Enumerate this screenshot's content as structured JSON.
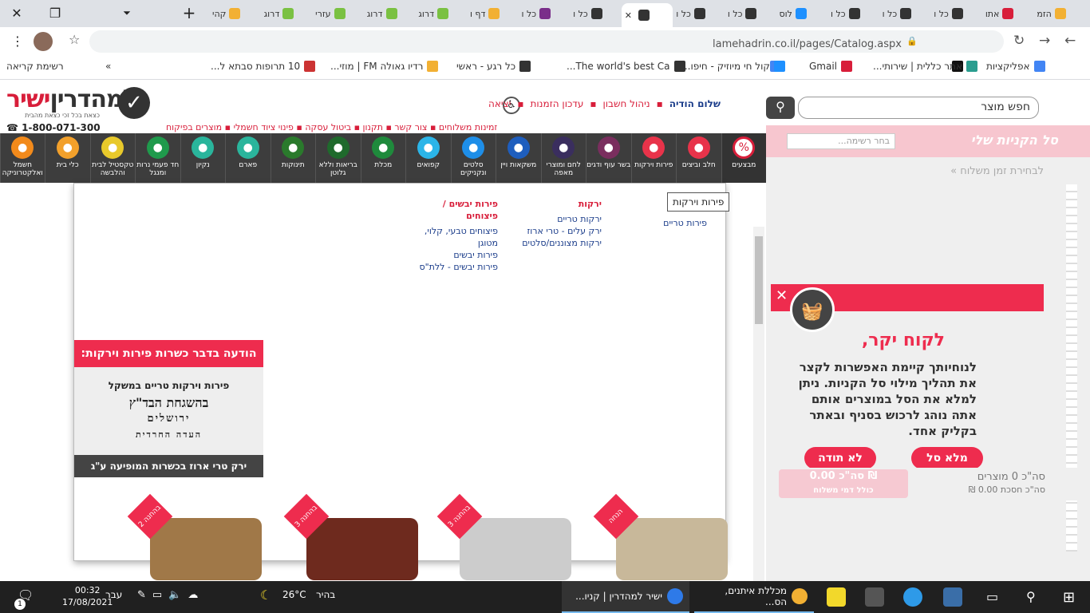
{
  "browser": {
    "tabs": [
      {
        "label": "הזמ",
        "color": "#f2b033"
      },
      {
        "label": "אתו",
        "color": "#d81e3a"
      },
      {
        "label": "כל ו",
        "color": "#333333"
      },
      {
        "label": "כל ו",
        "color": "#333333"
      },
      {
        "label": "כל ו",
        "color": "#333333"
      },
      {
        "label": "לוס",
        "color": "#1e90ff"
      },
      {
        "label": "כל ו",
        "color": "#333333"
      },
      {
        "label": "כל ו",
        "color": "#333333"
      },
      {
        "label": "",
        "color": "#333333",
        "active": true
      },
      {
        "label": "כל ו",
        "color": "#333333"
      },
      {
        "label": "כל ו",
        "color": "#7a2e8a"
      },
      {
        "label": "דף ו",
        "color": "#f2b033"
      },
      {
        "label": "דרוג",
        "color": "#7ac142"
      },
      {
        "label": "דרוג",
        "color": "#7ac142"
      },
      {
        "label": "עזרי",
        "color": "#7ac142"
      },
      {
        "label": "דרוג",
        "color": "#7ac142"
      },
      {
        "label": "קהי",
        "color": "#f2b033"
      }
    ],
    "url": "lamehadrin.co.il/pages/Catalog.aspx",
    "bookmarks": [
      {
        "label": "אפליקציות",
        "color": "#4285f4"
      },
      {
        "label": "",
        "color": "#111111"
      },
      {
        "label": "אתר כללית | שירותי...",
        "color": "#2a9d8f"
      },
      {
        "label": "Gmail",
        "color": "#d81e3a"
      },
      {
        "label": "",
        "color": "#4285f4"
      },
      {
        "label": "קול חי מיוזיק - חיפו...",
        "color": "#1e90ff"
      },
      {
        "label": "The world's best Ca...",
        "color": "#333333"
      },
      {
        "label": "כל רגע - ראשי",
        "color": "#333333"
      },
      {
        "label": "רדיו גאולה FM | מוזי...",
        "color": "#f2b033"
      },
      {
        "label": "10 תרופות סבתא ל...",
        "color": "#cc3333"
      },
      {
        "label": "»",
        "color": ""
      },
      {
        "label": "רשימת קריאה",
        "color": ""
      }
    ]
  },
  "site": {
    "logo_word_red": "ישיר",
    "logo_word_dark": "למהדרין",
    "logo_sub": "כצאת בכל זכי כצאת מהבית",
    "phone": "1-800-071-300",
    "greeting": "שלום הודיה",
    "topnav": [
      "ניהול חשבון",
      "עדכון הזמנות",
      "יציאה"
    ],
    "subnav": "זמינות משלוחים  ▪  צור קשר  ▪  תקנון  ▪  ביטול עסקה  ▪  פינוי ציוד חשמלי  ▪  מוצרים בפיקוח",
    "search_placeholder": "חפש מוצר",
    "categories": [
      {
        "label": "מבצעים",
        "sale": true,
        "color": "#ffffff"
      },
      {
        "label": "חלב וביצים",
        "color": "#e8334a"
      },
      {
        "label": "פירות וירקות",
        "color": "#e8334a"
      },
      {
        "label": "בשר עוף ודגים",
        "color": "#7a2e5e"
      },
      {
        "label": "לחם ומוצרי מאפה",
        "color": "#3a2e5e"
      },
      {
        "label": "משקאות ויין",
        "color": "#1e5ebe"
      },
      {
        "label": "סלטים ונקניקים",
        "color": "#1e8ee8"
      },
      {
        "label": "קפואים",
        "color": "#2bb5e8"
      },
      {
        "label": "מכלת",
        "color": "#1f8a3c"
      },
      {
        "label": "בריאות וללא גלוטן",
        "color": "#1f6a2c"
      },
      {
        "label": "תינוקות",
        "color": "#2a7a2c"
      },
      {
        "label": "פארם",
        "color": "#2ab59c"
      },
      {
        "label": "נקיון",
        "color": "#2ab59c"
      },
      {
        "label": "חד פעמי נרות ומנגל",
        "color": "#1f9a4c"
      },
      {
        "label": "טקסטיל לבית והלבשה",
        "color": "#e8c92b"
      },
      {
        "label": "כלי בית",
        "color": "#f2a02b"
      },
      {
        "label": "חשמל ואלקטרוניקה",
        "color": "#f28a1b"
      }
    ],
    "tooltip": "פירות וירקות",
    "menu": {
      "col1": {
        "heading": "",
        "items": [
          "פירות טריים"
        ]
      },
      "col2": {
        "heading": "ירקות",
        "items": [
          "ירקות טריים",
          "ירק עלים - טרי ארוז",
          "ירקות מצוננים/סלטים"
        ]
      },
      "col3": {
        "heading": "פירות יבשים / פיצוחים",
        "items": [
          "פיצוחים טבעי, קלוי, מטוגן",
          "פירות יבשים",
          "פירות יבשים - ללת\"ס"
        ]
      }
    },
    "notice": {
      "header": "הודעה בדבר כשרות פירות וירקות:",
      "line1": "פירות וירקות טריים במשקל",
      "stamp1": "בהשגחת הבד\"ץ",
      "stamp2": "ירושלים",
      "stamp3": "העדה החרדית",
      "footer": "ירק טרי ארוז בכשרות המופיעה ע\"ג האריזה"
    },
    "cart": {
      "title": "סל הקניות שלי",
      "list_placeholder": "בחר רשימה...",
      "time_link": "לבחירת זמן משלוח »",
      "popup_title": "לקוח יקר,",
      "popup_text": "לנוחיותך קיימת האפשרות לקצר את תהליך מילוי סל הקניות. ניתן למלא את הסל במוצרים אותם אתה נוהג לרכוש בסניף ובאתר בקליק אחד.",
      "btn_fill": "מלא סל",
      "btn_no": "לא תודה",
      "total_products": "סה\"כ 0 מוצרים",
      "total_savings": "סה\"כ חסכת 0.00 ₪",
      "total_sum": "סה\"כ 0.00 ₪",
      "delivery_note": "כולל דמי משלוח"
    },
    "products": [
      {
        "badge": "הנחה",
        "color": "#c8b89a"
      },
      {
        "badge": "3 בהחנה",
        "color": "#cccccc"
      },
      {
        "badge": "3 בהחנה",
        "color": "#6e2a1e"
      },
      {
        "badge": "2 בהחנה",
        "color": "#a07848"
      }
    ]
  },
  "taskbar": {
    "apps": [
      {
        "label": "ישיר למהדרין | קניו...",
        "color": "#2e7ae8"
      },
      {
        "label": "מכללת איתנים, הס...",
        "color": "#f2b033"
      }
    ],
    "weather_temp": "26°C",
    "weather_desc": "בהיר",
    "time": "00:32",
    "date": "17/08/2021",
    "lang": "עבר",
    "notif": "1"
  }
}
